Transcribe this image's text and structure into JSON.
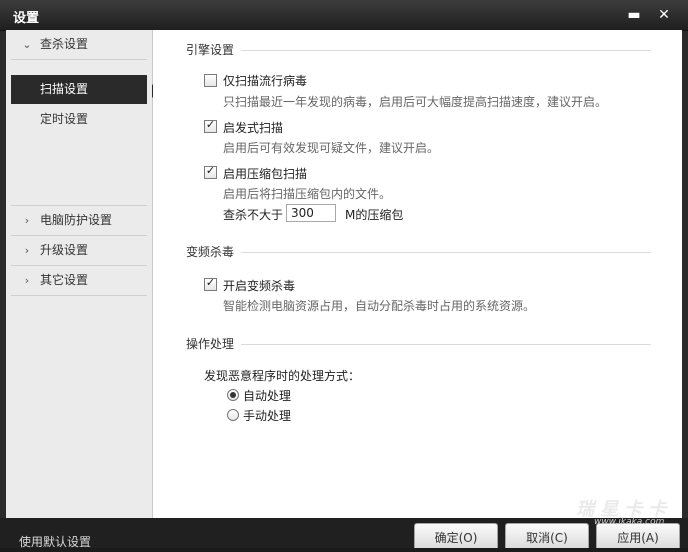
{
  "window": {
    "title": "设置",
    "min_icon": "minimize-icon",
    "close_icon": "close-icon"
  },
  "sidebar": {
    "items": [
      {
        "label": "查杀设置",
        "icon": "chevron-down-icon"
      },
      {
        "label": "扫描设置",
        "selected": true
      },
      {
        "label": "定时设置"
      },
      {
        "label": "电脑防护设置",
        "icon": "chevron-right-icon"
      },
      {
        "label": "升级设置",
        "icon": "chevron-right-icon"
      },
      {
        "label": "其它设置",
        "icon": "chevron-right-icon"
      }
    ]
  },
  "engine": {
    "header": "引擎设置",
    "opt1": {
      "label": "仅扫描流行病毒",
      "checked": false,
      "desc": "只扫描最近一年发现的病毒，启用后可大幅度提高扫描速度，建议开启。"
    },
    "opt2": {
      "label": "启发式扫描",
      "checked": true,
      "desc": "启用后可有效发现可疑文件，建议开启。"
    },
    "opt3": {
      "label": "启用压缩包扫描",
      "checked": true,
      "desc": "启用后将扫描压缩包内的文件。"
    },
    "size_prefix": "查杀不大于",
    "size_value": "300",
    "size_suffix": "M的压缩包"
  },
  "freq": {
    "header": "变频杀毒",
    "opt": {
      "label": "开启变频杀毒",
      "checked": true,
      "desc": "智能检测电脑资源占用，自动分配杀毒时占用的系统资源。"
    }
  },
  "action": {
    "header": "操作处理",
    "prompt": "发现恶意程序时的处理方式：",
    "radios": [
      {
        "label": "自动处理",
        "selected": true
      },
      {
        "label": "手动处理",
        "selected": false
      }
    ]
  },
  "footer": {
    "reset_label": "使用默认设置",
    "ok_label": "确定(O)",
    "cancel_label": "取消(C)",
    "apply_label": "应用(A)"
  },
  "watermark": {
    "text": "瑞星卡卡",
    "url": "www.ikaka.com"
  }
}
